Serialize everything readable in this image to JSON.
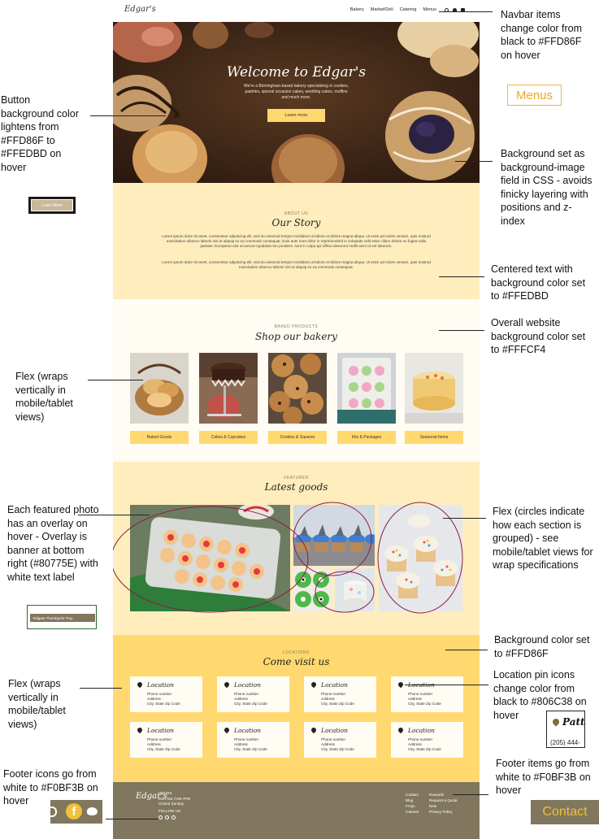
{
  "site": {
    "logo": "Edgar's",
    "nav": [
      "Bakery",
      "Market/Deli",
      "Catering",
      "Menus"
    ],
    "hero": {
      "title": "Welcome to Edgar's",
      "text": "We're a Birmingham-based bakery specializing in cookies, pastries, special occasion cakes, wedding cakes, muffins and much more.",
      "button": "Learn more"
    },
    "story": {
      "eyebrow": "ABOUT US",
      "title": "Our Story",
      "p1": "Lorem ipsum dolor sit amet, consectetur adipiscing elit, sed do eiusmod tempor incididunt ut labore et dolore magna aliqua. Ut enim ad minim veniam, quis nostrud exercitation ullamco laboris nisi ut aliquip ex ea commodo consequat. Duis aute irure dolor in reprehenderit in voluptate velit esse cillum dolore eu fugiat nulla pariatur. Excepteur sint occaecat cupidatat non proident, sunt in culpa qui officia deserunt mollit anim id est laborum.",
      "p2": "Lorem ipsum dolor sit amet, consectetur adipiscing elit, sed do eiusmod tempor incididunt ut labore et dolore magna aliqua. Ut enim ad minim veniam, quis nostrud exercitation ullamco laboris nisi ut aliquip ex ea commodo consequat."
    },
    "shop": {
      "eyebrow": "BAKED PRODUCTS",
      "title": "Shop our bakery",
      "products": [
        "Baked Goods",
        "Cakes & Cupcakes",
        "Cookies & Squares",
        "Kits & Packages",
        "Seasonal Items"
      ]
    },
    "latest": {
      "eyebrow": "FEATURED",
      "title": "Latest goods"
    },
    "visit": {
      "eyebrow": "LOCATIONS",
      "title": "Come visit us",
      "card": {
        "title": "Location",
        "phone": "Phone number",
        "address": "Address",
        "city": "City, State Zip Code"
      }
    },
    "footer": {
      "logo": "Edgar's",
      "hours_label": "HOURS",
      "hours": "Mon-Sat 7AM-7PM",
      "closed": "Closed Sunday",
      "follow": "FOLLOW US",
      "col1": [
        "Contact",
        "Blog",
        "FAQs",
        "Careers"
      ],
      "col2": [
        "Rewards",
        "Request a Quote",
        "New",
        "Privacy Policy"
      ]
    }
  },
  "annotations": {
    "navbar": "Navbar items change color from black to #FFD86F on hover",
    "menus": "Menus",
    "button": "Button background color lightens from #FFD86F to #FFEDBD on hover",
    "btn_mini": "Learn More",
    "hero_bg": "Background set as background-image field in CSS - avoids finicky layering with positions and z-index",
    "story_bg": "Centered text with background color set to #FFEDBD",
    "site_bg": "Overall website background color set to #FFFCF4",
    "flex_shop": "Flex (wraps vertically in mobile/tablet views)",
    "overlay": "Each featured photo has an overlay on hover - Overlay is banner at bottom right (#80775E) with white text label",
    "banner_label": "Tailgate Thumbprint Tray",
    "flex_latest": "Flex (circles indicate how each section is grouped) - see mobile/tablet views for wrap specifications",
    "visit_bg": "Background color set to #FFD86F",
    "flex_visit": "Flex (wraps vertically in mobile/tablet views)",
    "pin": "Location pin icons change color from black to #806C38 on hover",
    "pin_card_title": "Patt",
    "pin_card_phone": "(205) 444-",
    "footer_icons": "Footer icons go from white to #F0BF3B on hover",
    "footer_items": "Footer items go from white to #F0BF3B on hover",
    "contact": "Contact"
  },
  "colors": {
    "yellow": "#FFD86F",
    "light_yellow": "#FFEDBD",
    "cream": "#FFFCF4",
    "brown": "#80775E",
    "hover_gold": "#F0BF3B",
    "pin_hover": "#806C38",
    "ellipse": "#8B1A4A"
  }
}
